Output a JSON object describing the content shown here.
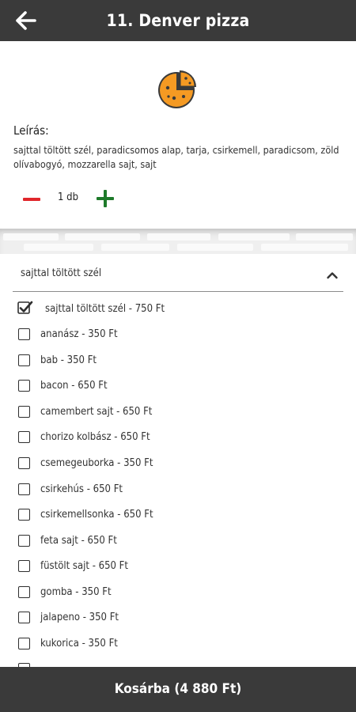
{
  "header": {
    "title": "11. Denver pizza",
    "back_icon": "arrow-left-icon"
  },
  "product": {
    "icon": "pizza-icon",
    "description_label": "Leírás:",
    "description": "sajttal töltött szél, paradicsomos alap, tarja, csirkemell, paradicsom, zöld olívabogyó, mozzarella sajt, sajt",
    "quantity": "1 db"
  },
  "options": {
    "section_title": "sajttal töltött szél",
    "items": [
      {
        "label": "sajttal töltött szél - 750 Ft",
        "checked": true
      },
      {
        "label": "ananász - 350 Ft",
        "checked": false
      },
      {
        "label": "bab - 350 Ft",
        "checked": false
      },
      {
        "label": "bacon - 650 Ft",
        "checked": false
      },
      {
        "label": "camembert sajt - 650 Ft",
        "checked": false
      },
      {
        "label": "chorizo kolbász - 650 Ft",
        "checked": false
      },
      {
        "label": "csemegeuborka - 350 Ft",
        "checked": false
      },
      {
        "label": "csirkehús - 650 Ft",
        "checked": false
      },
      {
        "label": "csirkemellsonka - 650 Ft",
        "checked": false
      },
      {
        "label": "feta sajt - 650 Ft",
        "checked": false
      },
      {
        "label": "füstölt sajt - 650 Ft",
        "checked": false
      },
      {
        "label": "gomba - 350 Ft",
        "checked": false
      },
      {
        "label": "jalapeno - 350 Ft",
        "checked": false
      },
      {
        "label": "kukorica - 350 Ft",
        "checked": false
      }
    ]
  },
  "footer": {
    "cart_label": "Kosárba (4 880 Ft)"
  },
  "colors": {
    "bar": "#3a3a3a",
    "minus": "#e0262b",
    "plus": "#1e7a2a",
    "pizza": "#f59a23"
  }
}
